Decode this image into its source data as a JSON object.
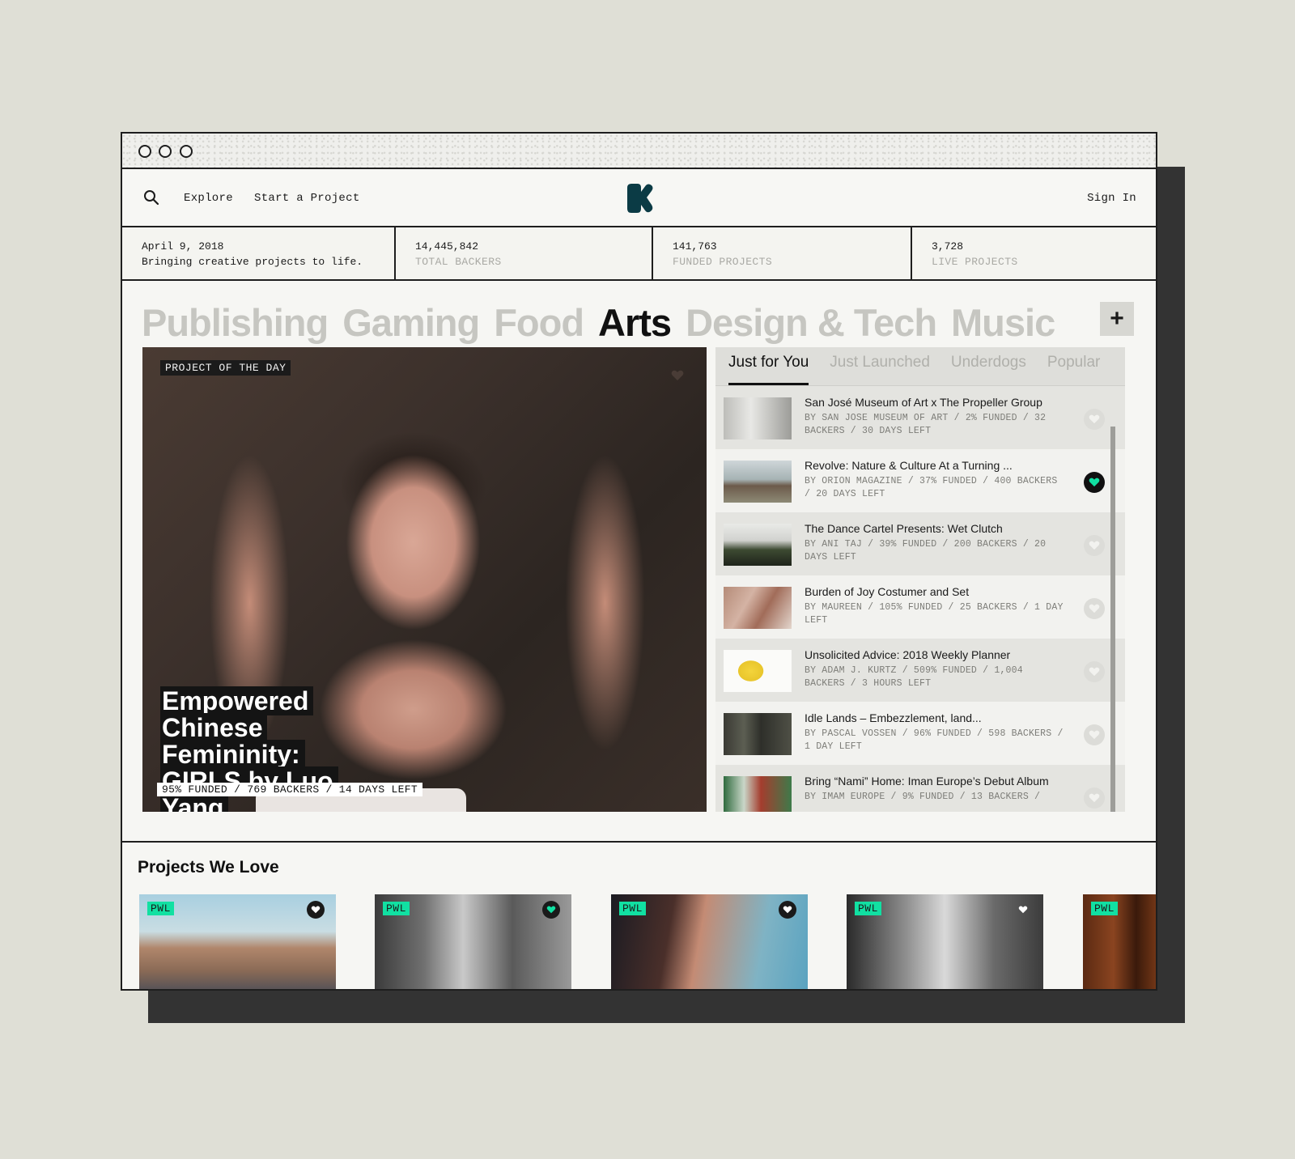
{
  "nav": {
    "explore": "Explore",
    "start_project": "Start a Project",
    "sign_in": "Sign In"
  },
  "stats": {
    "date": "April 9, 2018",
    "tagline": "Bringing creative projects to life.",
    "backers_value": "14,445,842",
    "backers_label": "TOTAL BACKERS",
    "funded_value": "141,763",
    "funded_label": "FUNDED PROJECTS",
    "live_value": "3,728",
    "live_label": "LIVE PROJECTS"
  },
  "categories": [
    {
      "label": "Publishing",
      "active": false
    },
    {
      "label": "Gaming",
      "active": false
    },
    {
      "label": "Food",
      "active": false
    },
    {
      "label": "Arts",
      "active": true
    },
    {
      "label": "Design & Tech",
      "active": false
    },
    {
      "label": "Music",
      "active": false
    }
  ],
  "plus_label": "+",
  "hero": {
    "badge": "PROJECT OF THE DAY",
    "title_lines": [
      "Empowered",
      "Chinese Femininity:",
      "GIRLS by Luo Yang"
    ],
    "stats": "95% FUNDED / 769 BACKERS / 14 DAYS LEFT"
  },
  "tabs": [
    {
      "label": "Just for You",
      "active": true
    },
    {
      "label": "Just Launched",
      "active": false
    },
    {
      "label": "Underdogs",
      "active": false
    },
    {
      "label": "Popular",
      "active": false
    }
  ],
  "projects": [
    {
      "title": "San José Museum of Art x The Propeller Group",
      "meta": "BY SAN JOSE MUSEUM OF ART / 2% FUNDED / 32 BACKERS / 30 DAYS LEFT",
      "liked": false
    },
    {
      "title": "Revolve: Nature & Culture At a Turning ...",
      "meta": "BY ORION MAGAZINE / 37% FUNDED / 400 BACKERS / 20 DAYS LEFT",
      "liked": true
    },
    {
      "title": "The Dance Cartel Presents: Wet Clutch",
      "meta": "BY ANI TAJ / 39% FUNDED / 200 BACKERS / 20 DAYS LEFT",
      "liked": false
    },
    {
      "title": "Burden of Joy Costumer and Set",
      "meta": "BY MAUREEN / 105% FUNDED / 25 BACKERS / 1 DAY LEFT",
      "liked": false
    },
    {
      "title": "Unsolicited Advice: 2018 Weekly Planner",
      "meta": "BY ADAM J. KURTZ / 509% FUNDED / 1,004 BACKERS / 3 HOURS LEFT",
      "liked": false
    },
    {
      "title": "Idle Lands – Embezzlement, land...",
      "meta": "BY PASCAL VOSSEN / 96% FUNDED / 598 BACKERS / 1 DAY LEFT",
      "liked": false
    },
    {
      "title": "Bring “Nami” Home: Iman Europe’s Debut Album",
      "meta": "BY IMAM EUROPE / 9% FUNDED / 13 BACKERS /",
      "liked": false
    }
  ],
  "pwl": {
    "title": "Projects We Love",
    "tag": "PWL"
  },
  "colors": {
    "accent": "#11e0a2",
    "brand": "#0b3b45"
  }
}
